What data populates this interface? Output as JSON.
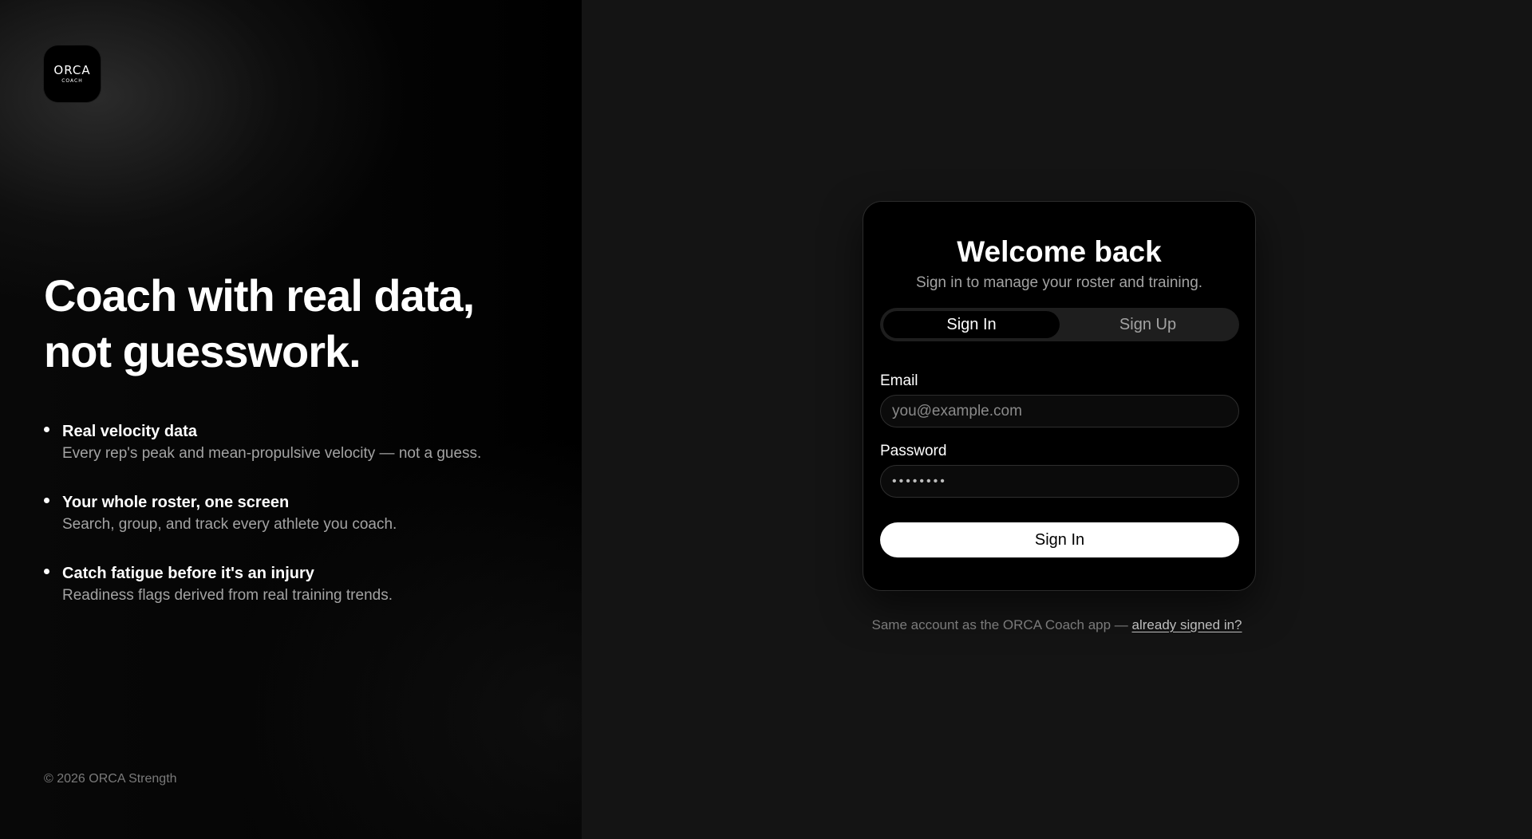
{
  "brand": {
    "logo_word": "ORCA",
    "logo_sub": "COACH",
    "icon": "orca-coach-logo-icon"
  },
  "hero": {
    "title": "Coach with real data,\nnot guesswork."
  },
  "features": [
    {
      "title": "Real velocity data",
      "description": "Every rep's peak and mean-propulsive velocity — not a guess."
    },
    {
      "title": "Your whole roster, one screen",
      "description": "Search, group, and track every athlete you coach."
    },
    {
      "title": "Catch fatigue before it's an injury",
      "description": "Readiness flags derived from real training trends."
    }
  ],
  "copyright": "© 2026 ORCA Strength",
  "auth_card": {
    "title": "Welcome back",
    "subtitle": "Sign in to manage your roster and training.",
    "tabs": [
      {
        "label": "Sign In",
        "active": true
      },
      {
        "label": "Sign Up",
        "active": false
      }
    ],
    "email": {
      "label": "Email",
      "placeholder": "you@example.com",
      "value": ""
    },
    "password": {
      "label": "Password",
      "value": "••••••••"
    },
    "submit_label": "Sign In"
  },
  "footer_note": {
    "text": "Same account as the ORCA Coach app — ",
    "link_label": "already signed in?"
  },
  "colors": {
    "background": "#141414",
    "card": "#000000",
    "muted_text": "#a3a3a3",
    "primary_button": "#ffffff"
  }
}
